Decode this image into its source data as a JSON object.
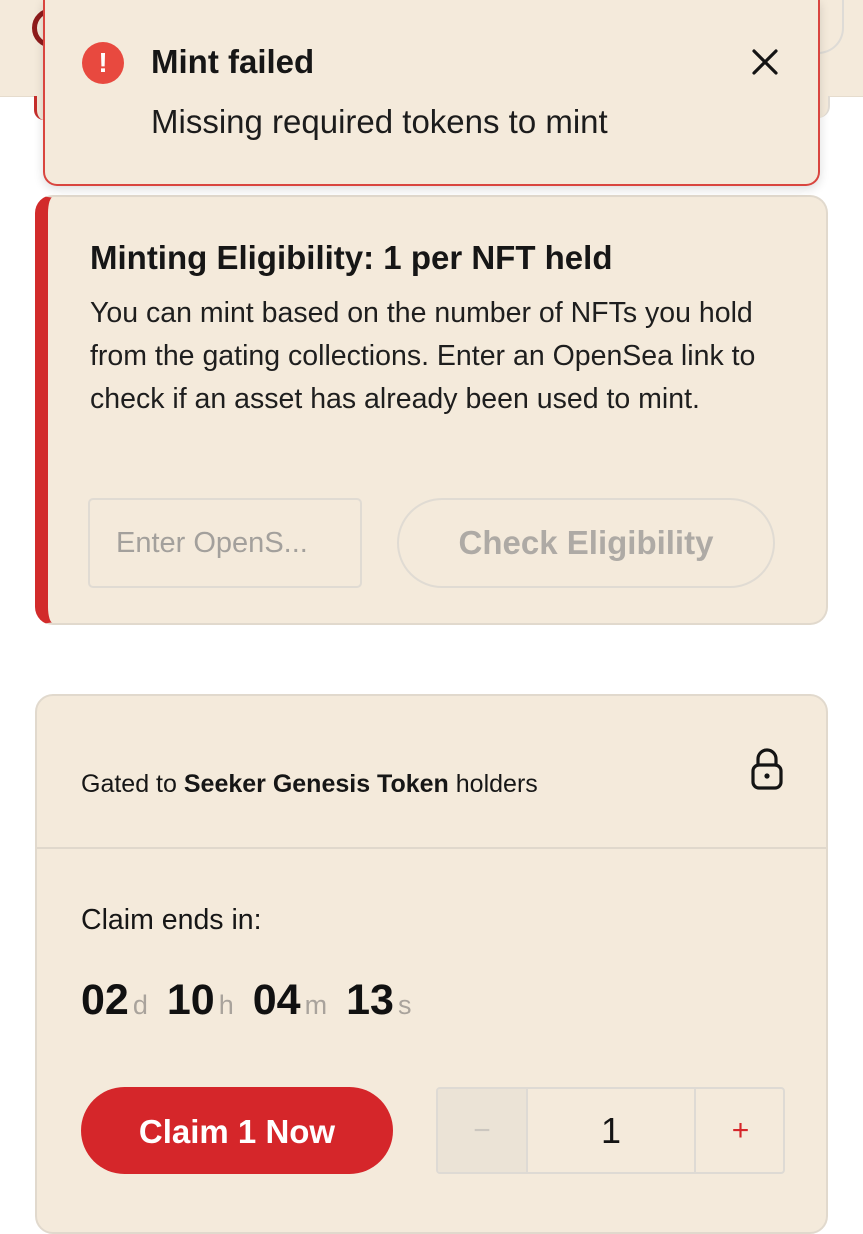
{
  "toast": {
    "icon": "exclamation-icon",
    "icon_glyph": "!",
    "title": "Mint failed",
    "message": "Missing required tokens to mint",
    "close_icon": "close-icon"
  },
  "eligibility": {
    "title": "Minting Eligibility: 1 per NFT held",
    "description": "You can mint based on the number of NFTs you hold from the gating collections. Enter an OpenSea link to check if an asset has already been used to mint.",
    "input_placeholder": "Enter OpenS...",
    "input_value": "",
    "check_button_label": "Check Eligibility"
  },
  "claim": {
    "gated_prefix": "Gated to ",
    "gated_token": "Seeker Genesis Token",
    "gated_suffix": " holders",
    "lock_icon": "lock-icon",
    "ends_label": "Claim ends in:",
    "countdown": {
      "days": "02",
      "days_unit": "d",
      "hours": "10",
      "hours_unit": "h",
      "minutes": "04",
      "minutes_unit": "m",
      "seconds": "13",
      "seconds_unit": "s"
    },
    "claim_button_label": "Claim 1 Now",
    "quantity": {
      "minus": "−",
      "value": "1",
      "plus": "+"
    }
  },
  "colors": {
    "accent_red": "#d5262a",
    "toast_icon_red": "#e8493f",
    "card_background": "#f4eadb",
    "muted_text": "#aeaaa5"
  }
}
